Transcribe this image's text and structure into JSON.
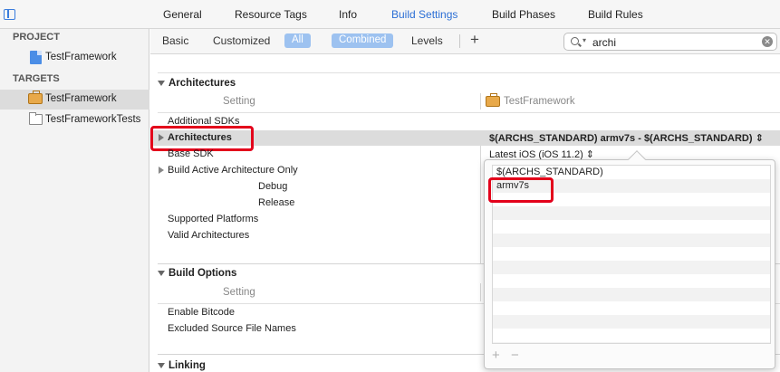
{
  "tabs": [
    "General",
    "Resource Tags",
    "Info",
    "Build Settings",
    "Build Phases",
    "Build Rules"
  ],
  "active_tab": "Build Settings",
  "sidebar": {
    "project_header": "PROJECT",
    "project_item": "TestFramework",
    "targets_header": "TARGETS",
    "target_items": [
      "TestFramework",
      "TestFrameworkTests"
    ]
  },
  "filter": {
    "basic": "Basic",
    "customized": "Customized",
    "all": "All",
    "combined": "Combined",
    "levels": "Levels",
    "add": "+",
    "search_value": "archi"
  },
  "sections": {
    "architectures": "Architectures",
    "build_options": "Build Options",
    "linking": "Linking"
  },
  "columns": {
    "setting": "Setting",
    "target": "TestFramework"
  },
  "rows": {
    "additional_sdks": "Additional SDKs",
    "architectures": "Architectures",
    "architectures_value": "$(ARCHS_STANDARD) armv7s  -  $(ARCHS_STANDARD) ⇕",
    "base_sdk": "Base SDK",
    "base_sdk_value": "Latest iOS (iOS 11.2) ⇕",
    "build_active_arch": "Build Active Architecture Only",
    "debug": "Debug",
    "release": "Release",
    "supported_platforms": "Supported Platforms",
    "valid_architectures": "Valid Architectures",
    "enable_bitcode": "Enable Bitcode",
    "excluded_source": "Excluded Source File Names"
  },
  "popover": {
    "items": [
      "$(ARCHS_STANDARD)",
      "armv7s"
    ],
    "add": "+",
    "remove": "−"
  },
  "colors": {
    "accent": "#2c6fd5",
    "highlight": "#e3001b",
    "pill": "#9dc2f0"
  }
}
